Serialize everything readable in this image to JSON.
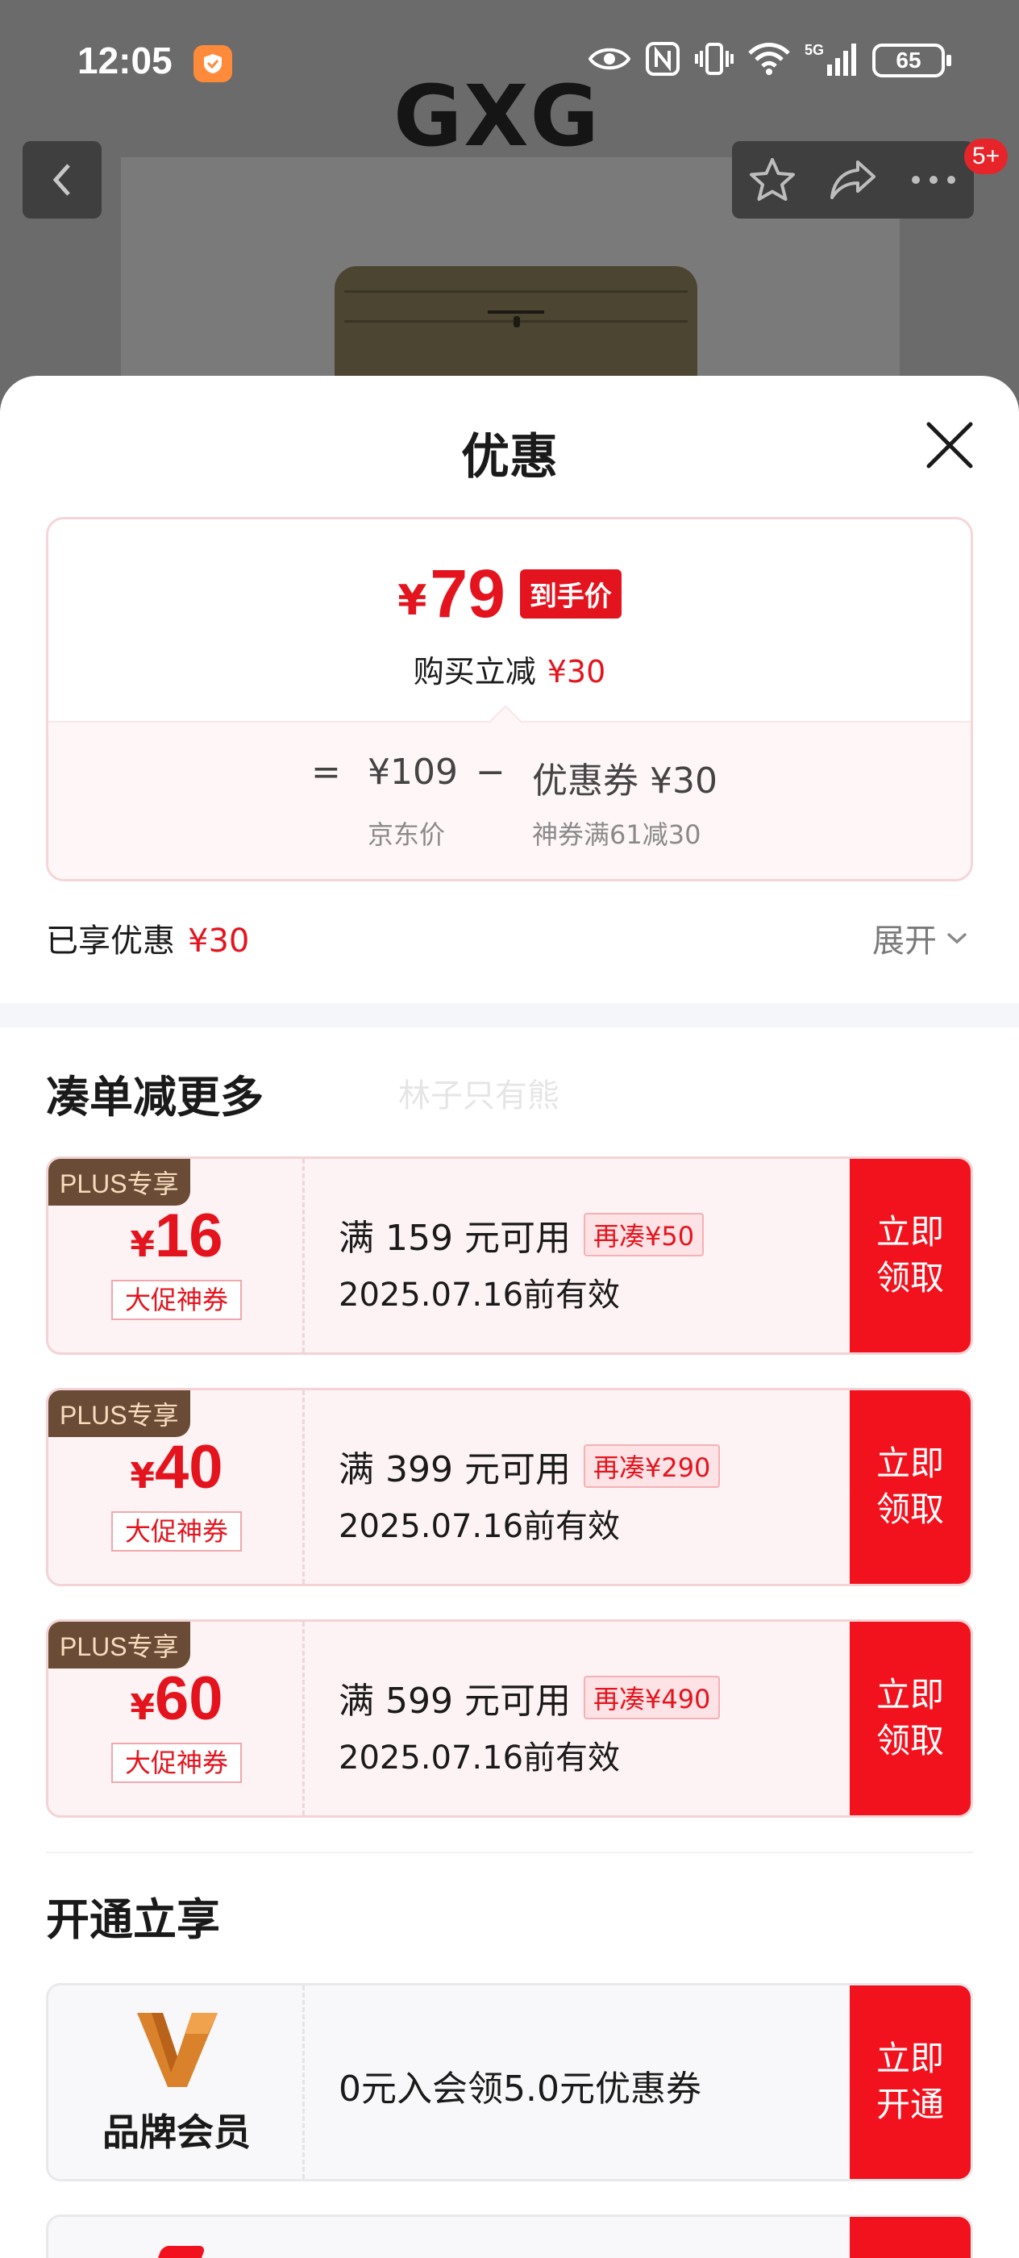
{
  "status_bar": {
    "time": "12:05",
    "battery": "65",
    "network": "5G",
    "icons": [
      "eye-icon",
      "nfc-icon",
      "vibrate-icon",
      "wifi-icon",
      "signal-icon",
      "battery-icon"
    ]
  },
  "background": {
    "brand": "GXG",
    "notification_count": "5+"
  },
  "sheet": {
    "title": "优惠",
    "price": {
      "currency": "¥",
      "final": "79",
      "final_tag": "到手价",
      "buy_label": "购买立减",
      "buy_reduction": "¥30",
      "equals": "=",
      "jd_price": "¥109",
      "minus": "−",
      "coupon_text": "优惠券 ¥30",
      "jd_label": "京东价",
      "coupon_label": "神券满61减30"
    },
    "enjoyed_label": "已享优惠",
    "enjoyed_value": "¥30",
    "expand_label": "展开"
  },
  "more_section": {
    "title": "凑单减更多",
    "watermark": "林子只有熊",
    "coupons": [
      {
        "tag": "PLUS专享",
        "currency": "¥",
        "amount": "16",
        "type": "大促神券",
        "condition": "满 159 元可用",
        "extra": "再凑¥50",
        "valid": "2025.07.16前有效",
        "cta_line1": "立即",
        "cta_line2": "领取"
      },
      {
        "tag": "PLUS专享",
        "currency": "¥",
        "amount": "40",
        "type": "大促神券",
        "condition": "满 399 元可用",
        "extra": "再凑¥290",
        "valid": "2025.07.16前有效",
        "cta_line1": "立即",
        "cta_line2": "领取"
      },
      {
        "tag": "PLUS专享",
        "currency": "¥",
        "amount": "60",
        "type": "大促神券",
        "condition": "满 599 元可用",
        "extra": "再凑¥490",
        "valid": "2025.07.16前有效",
        "cta_line1": "立即",
        "cta_line2": "领取"
      }
    ]
  },
  "open_section": {
    "title": "开通立享",
    "member": {
      "name": "品牌会员",
      "desc": "0元入会领5.0元优惠券",
      "cta_line1": "立即",
      "cta_line2": "开通"
    }
  },
  "colors": {
    "accent_red": "#e4141e",
    "plus_brown": "#6a4b35",
    "member_gold": "#d9822b"
  }
}
